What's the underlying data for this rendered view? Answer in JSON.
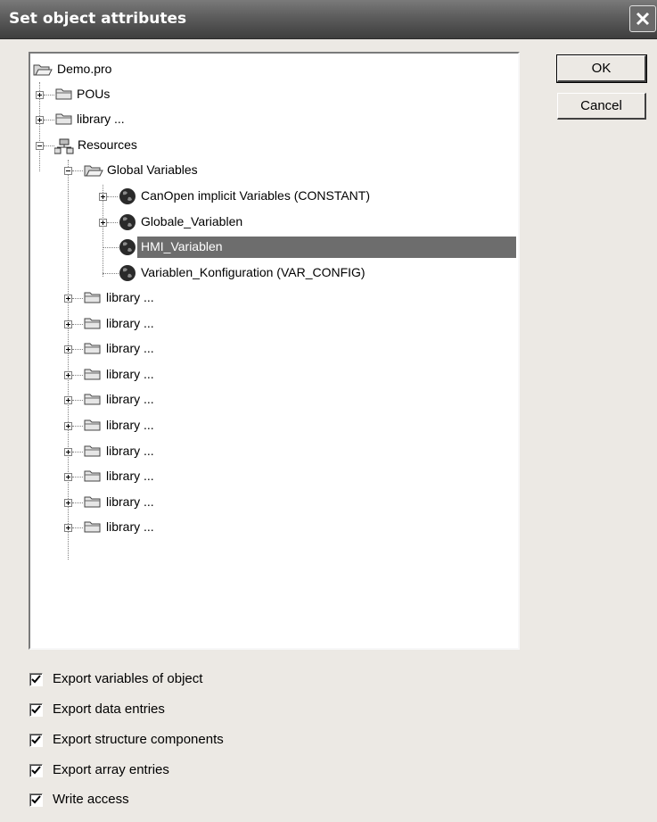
{
  "window": {
    "title": "Set object attributes"
  },
  "tree": {
    "root": "Demo.pro",
    "nodes": [
      {
        "label": "POUs",
        "icon": "folder-icon",
        "expander": "plus"
      },
      {
        "label": "library ...",
        "icon": "folder-icon",
        "expander": "plus"
      },
      {
        "label": "Resources",
        "icon": "resources-icon",
        "expander": "minus"
      },
      {
        "label": "Global Variables",
        "icon": "folder-open-icon",
        "expander": "minus"
      },
      {
        "label": "CanOpen implicit Variables (CONSTANT)",
        "icon": "globe-icon",
        "expander": "plus"
      },
      {
        "label": "Globale_Variablen",
        "icon": "globe-icon",
        "expander": "plus"
      },
      {
        "label": "HMI_Variablen",
        "icon": "globe-icon",
        "expander": "none",
        "selected": true
      },
      {
        "label": "Variablen_Konfiguration (VAR_CONFIG)",
        "icon": "globe-icon",
        "expander": "none"
      }
    ],
    "libraries": [
      "library ...",
      "library ...",
      "library ...",
      "library ...",
      "library ...",
      "library ...",
      "library ...",
      "library ...",
      "library ...",
      "library ..."
    ]
  },
  "buttons": {
    "ok": "OK",
    "cancel": "Cancel"
  },
  "options": [
    {
      "label": "Export variables of object",
      "checked": true
    },
    {
      "label": "Export data entries",
      "checked": true
    },
    {
      "label": "Export structure components",
      "checked": true
    },
    {
      "label": "Export array entries",
      "checked": true
    },
    {
      "label": "Write access",
      "checked": true
    }
  ],
  "colors": {
    "dialog_bg": "#ece9e4",
    "selection": "#6d6d6d"
  }
}
